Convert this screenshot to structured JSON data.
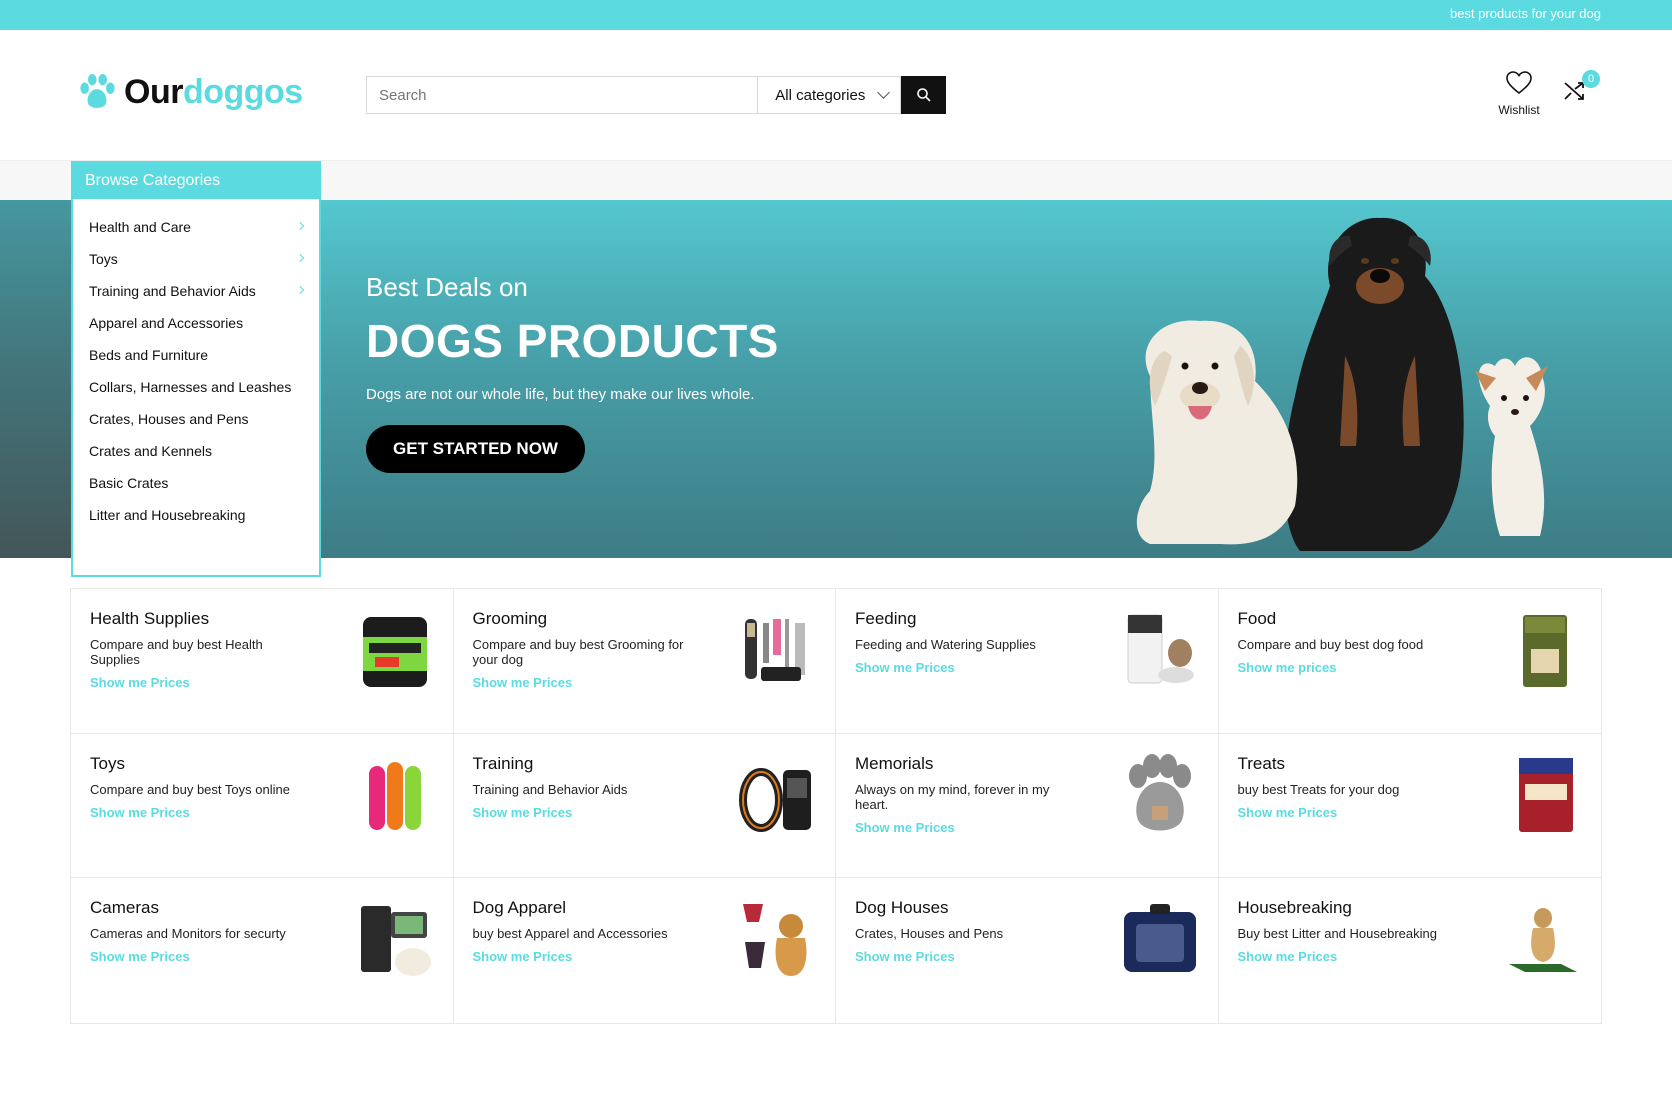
{
  "topbar": {
    "tagline": "best products for your dog"
  },
  "header": {
    "brand_part1": "Our",
    "brand_part2": "doggos",
    "search_placeholder": "Search",
    "category_select": "All categories",
    "wishlist_label": "Wishlist",
    "compare_count": "0"
  },
  "sidebar": {
    "title": "Browse Categories",
    "items": [
      {
        "label": "Health and Care"
      },
      {
        "label": "Toys"
      },
      {
        "label": "Training and Behavior Aids"
      },
      {
        "label": "Apparel and Accessories"
      },
      {
        "label": "Beds and Furniture"
      },
      {
        "label": "Collars, Harnesses and Leashes"
      },
      {
        "label": "Crates, Houses and Pens"
      },
      {
        "label": "Crates and Kennels"
      },
      {
        "label": "Basic Crates"
      },
      {
        "label": "Litter and Housebreaking"
      }
    ]
  },
  "hero": {
    "pre_title": "Best Deals on",
    "title": "DOGS PRODUCTS",
    "subtitle": "Dogs are not our whole life, but they make our lives whole.",
    "cta": "GET STARTED NOW"
  },
  "categories": [
    {
      "title": "Health Supplies",
      "desc": "Compare and buy best Health Supplies",
      "link": "Show me Prices"
    },
    {
      "title": "Grooming",
      "desc": "Compare and buy best Grooming for your dog",
      "link": "Show me Prices"
    },
    {
      "title": "Feeding",
      "desc": "Feeding and Watering Supplies",
      "link": "Show me Prices"
    },
    {
      "title": "Food",
      "desc": "Compare and buy best dog food",
      "link": "Show me prices"
    },
    {
      "title": "Toys",
      "desc": "Compare and buy best Toys online",
      "link": "Show me Prices"
    },
    {
      "title": "Training",
      "desc": "Training and Behavior Aids",
      "link": "Show me Prices"
    },
    {
      "title": "Memorials",
      "desc": "Always on my mind, forever in my heart.",
      "link": "Show me Prices"
    },
    {
      "title": "Treats",
      "desc": "buy best Treats for your dog",
      "link": "Show me Prices"
    },
    {
      "title": "Cameras",
      "desc": "Cameras and Monitors for securty",
      "link": "Show me Prices"
    },
    {
      "title": "Dog Apparel",
      "desc": "buy best Apparel and Accessories",
      "link": "Show me Prices"
    },
    {
      "title": "Dog Houses",
      "desc": "Crates, Houses and Pens",
      "link": "Show me Prices"
    },
    {
      "title": "Housebreaking",
      "desc": "Buy best Litter and Housebreaking",
      "link": "Show me Prices"
    }
  ],
  "colors": {
    "accent": "#5bdbe0",
    "dark": "#111111"
  },
  "icons": [
    "paw-icon",
    "search-icon",
    "chevron-down-icon",
    "heart-icon",
    "compare-icon",
    "chevron-right-icon"
  ]
}
